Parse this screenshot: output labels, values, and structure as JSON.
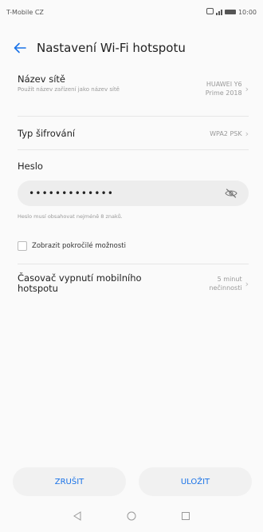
{
  "status_bar": {
    "carrier": "T-Mobile CZ",
    "time": "10:00"
  },
  "header": {
    "title": "Nastavení Wi-Fi hotspotu"
  },
  "network_name": {
    "label": "Název sítě",
    "description": "Použít název zařízení jako název sítě",
    "value_line1": "HUAWEI Y6",
    "value_line2": "Prime 2018"
  },
  "encryption": {
    "label": "Typ šifrování",
    "value": "WPA2 PSK"
  },
  "password": {
    "label": "Heslo",
    "value": "•••••••••••••",
    "hint": "Heslo musí obsahovat nejméně 8 znaků."
  },
  "advanced": {
    "label": "Zobrazit pokročilé možnosti",
    "checked": false
  },
  "timer": {
    "label_line1": "Časovač vypnutí mobilního",
    "label_line2": "hotspotu",
    "value_line1": "5 minut",
    "value_line2": "nečinnosti"
  },
  "buttons": {
    "cancel": "ZRUŠIT",
    "save": "ULOŽIT"
  },
  "colors": {
    "accent": "#1a73e8"
  }
}
